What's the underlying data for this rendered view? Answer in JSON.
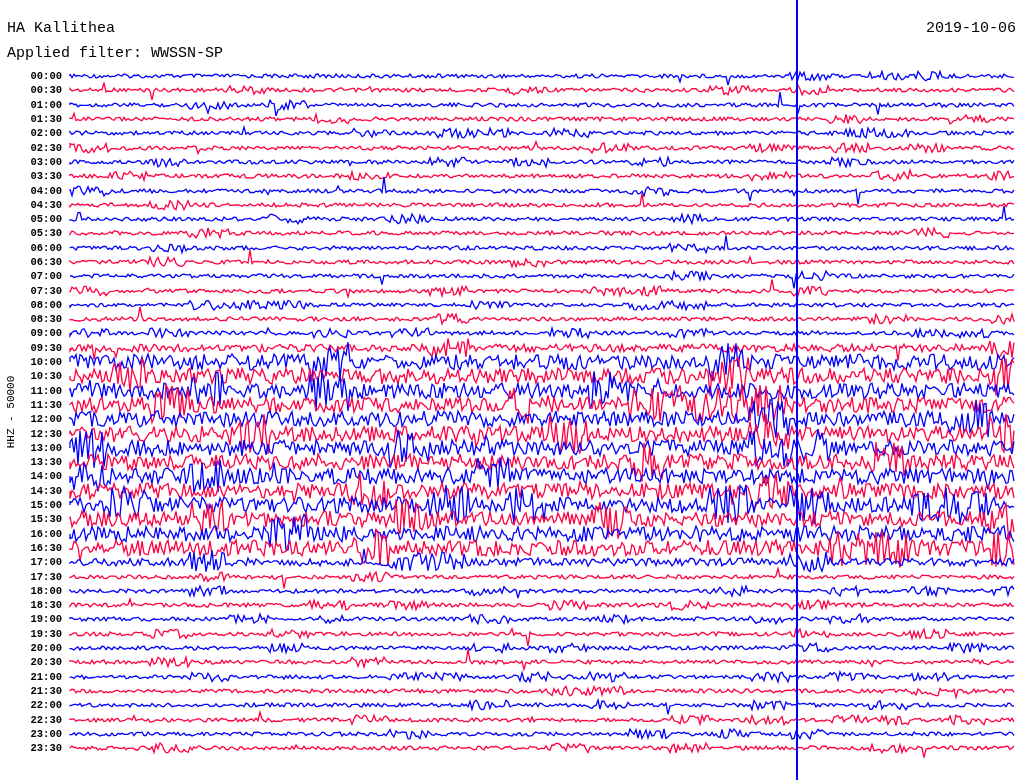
{
  "header": {
    "station": "HA Kallithea",
    "date": "2019-10-06",
    "filter": "Applied filter: WWSSN-SP"
  },
  "axis_label": "HHZ - 50000",
  "trace_rows": [
    {
      "time": "00:00",
      "color": "#0000ff"
    },
    {
      "time": "00:30",
      "color": "#ff0040"
    },
    {
      "time": "01:00",
      "color": "#0000ff"
    },
    {
      "time": "01:30",
      "color": "#ff0040"
    },
    {
      "time": "02:00",
      "color": "#0000ff"
    },
    {
      "time": "02:30",
      "color": "#ff0040"
    },
    {
      "time": "03:00",
      "color": "#0000ff"
    },
    {
      "time": "03:30",
      "color": "#ff0040"
    },
    {
      "time": "04:00",
      "color": "#0000ff"
    },
    {
      "time": "04:30",
      "color": "#ff0040"
    },
    {
      "time": "05:00",
      "color": "#0000ff"
    },
    {
      "time": "05:30",
      "color": "#ff0040"
    },
    {
      "time": "06:00",
      "color": "#0000ff"
    },
    {
      "time": "06:30",
      "color": "#ff0040"
    },
    {
      "time": "07:00",
      "color": "#0000ff"
    },
    {
      "time": "07:30",
      "color": "#ff0040"
    },
    {
      "time": "08:00",
      "color": "#0000ff"
    },
    {
      "time": "08:30",
      "color": "#ff0040"
    },
    {
      "time": "09:00",
      "color": "#0000ff"
    },
    {
      "time": "09:30",
      "color": "#ff0040"
    },
    {
      "time": "10:00",
      "color": "#0000ff"
    },
    {
      "time": "10:30",
      "color": "#ff0040"
    },
    {
      "time": "11:00",
      "color": "#0000ff"
    },
    {
      "time": "11:30",
      "color": "#ff0040"
    },
    {
      "time": "12:00",
      "color": "#0000ff"
    },
    {
      "time": "12:30",
      "color": "#ff0040"
    },
    {
      "time": "13:00",
      "color": "#0000ff"
    },
    {
      "time": "13:30",
      "color": "#ff0040"
    },
    {
      "time": "14:00",
      "color": "#0000ff"
    },
    {
      "time": "14:30",
      "color": "#ff0040"
    },
    {
      "time": "15:00",
      "color": "#0000ff"
    },
    {
      "time": "15:30",
      "color": "#ff0040"
    },
    {
      "time": "16:00",
      "color": "#0000ff"
    },
    {
      "time": "16:30",
      "color": "#ff0040"
    },
    {
      "time": "17:00",
      "color": "#0000ff"
    },
    {
      "time": "17:30",
      "color": "#ff0040"
    },
    {
      "time": "18:00",
      "color": "#0000ff"
    },
    {
      "time": "18:30",
      "color": "#ff0040"
    },
    {
      "time": "19:00",
      "color": "#0000ff"
    },
    {
      "time": "19:30",
      "color": "#ff0040"
    },
    {
      "time": "20:00",
      "color": "#0000ff"
    },
    {
      "time": "20:30",
      "color": "#ff0040"
    },
    {
      "time": "21:00",
      "color": "#0000ff"
    },
    {
      "time": "21:30",
      "color": "#ff0040"
    },
    {
      "time": "22:00",
      "color": "#0000ff"
    },
    {
      "time": "22:30",
      "color": "#ff0040"
    },
    {
      "time": "23:00",
      "color": "#0000ff"
    },
    {
      "time": "23:30",
      "color": "#ff0040"
    }
  ]
}
